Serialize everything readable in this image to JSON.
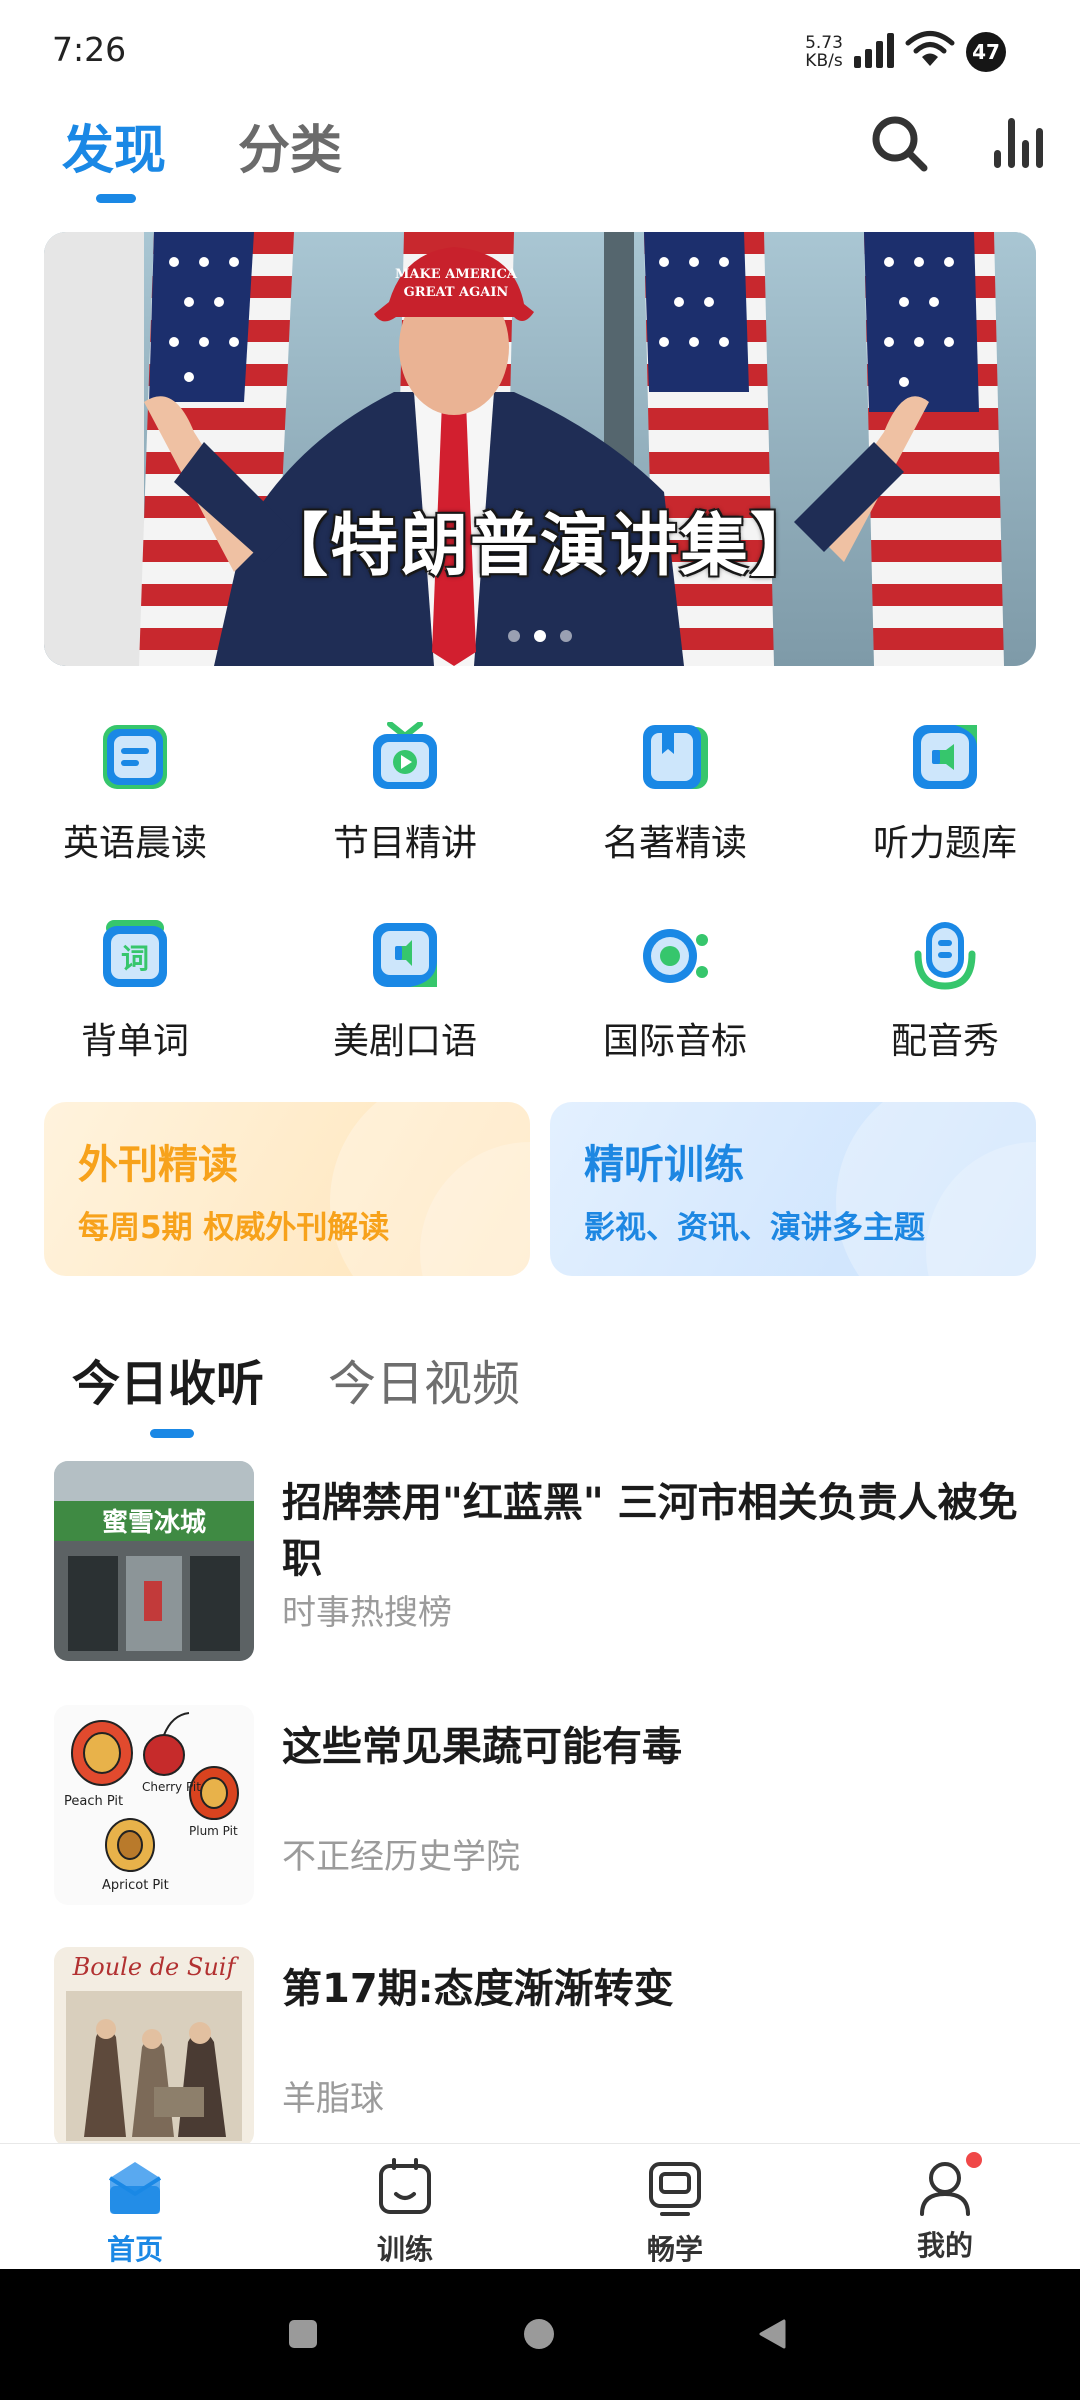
{
  "status_bar": {
    "time": "7:26",
    "net_speed_value": "5.73",
    "net_speed_unit": "KB/s",
    "battery": "47",
    "icons": [
      "signal-icon",
      "wifi-icon",
      "battery-icon"
    ]
  },
  "header": {
    "tabs": [
      {
        "label": "发现",
        "active": true
      },
      {
        "label": "分类",
        "active": false
      }
    ],
    "actions": [
      "search-icon",
      "chart-icon"
    ]
  },
  "banner": {
    "caption": "【特朗普演讲集】",
    "hat_text_line1": "MAKE AMERICA",
    "hat_text_line2": "GREAT AGAIN",
    "slide_count": 3,
    "active_slide": 2
  },
  "features": [
    {
      "label": "英语晨读",
      "icon": "morning-read-icon"
    },
    {
      "label": "节目精讲",
      "icon": "program-tv-icon"
    },
    {
      "label": "名著精读",
      "icon": "classic-book-icon"
    },
    {
      "label": "听力题库",
      "icon": "listening-bank-icon"
    },
    {
      "label": "背单词",
      "icon": "vocabulary-icon"
    },
    {
      "label": "美剧口语",
      "icon": "tv-speaking-icon"
    },
    {
      "label": "国际音标",
      "icon": "phonetics-icon"
    },
    {
      "label": "配音秀",
      "icon": "dubbing-icon"
    }
  ],
  "promos": [
    {
      "title": "外刊精读",
      "subtitle": "每周5期 权威外刊解读",
      "color": "#f7a21b"
    },
    {
      "title": "精听训练",
      "subtitle": "影视、资讯、演讲多主题",
      "color": "#1d87e2"
    }
  ],
  "content_tabs": [
    {
      "label": "今日收听",
      "active": true
    },
    {
      "label": "今日视频",
      "active": false
    }
  ],
  "articles": [
    {
      "title": "招牌禁用\"红蓝黑\" 三河市相关负责人被免职",
      "source": "时事热搜榜",
      "thumb_text": "蜜雪冰城"
    },
    {
      "title": "这些常见果蔬可能有毒",
      "source": "不正经历史学院",
      "thumb_labels": [
        "Peach Pit",
        "Cherry Pit",
        "Plum Pit",
        "Apricot Pit"
      ]
    },
    {
      "title": "第17期:态度渐渐转变",
      "source": "羊脂球",
      "thumb_text": "Boule de Suif"
    }
  ],
  "bottom_nav": [
    {
      "label": "首页",
      "icon": "home-icon",
      "active": true
    },
    {
      "label": "训练",
      "icon": "training-icon",
      "active": false
    },
    {
      "label": "畅学",
      "icon": "learn-icon",
      "active": false
    },
    {
      "label": "我的",
      "icon": "profile-icon",
      "active": false,
      "badge": true
    }
  ],
  "colors": {
    "accent": "#1a88e5",
    "accent_green": "#33c86a",
    "promo_orange": "#f7a21b",
    "promo_blue": "#1d87e2",
    "muted_text": "#9b9b9b",
    "badge_red": "#f04848"
  }
}
